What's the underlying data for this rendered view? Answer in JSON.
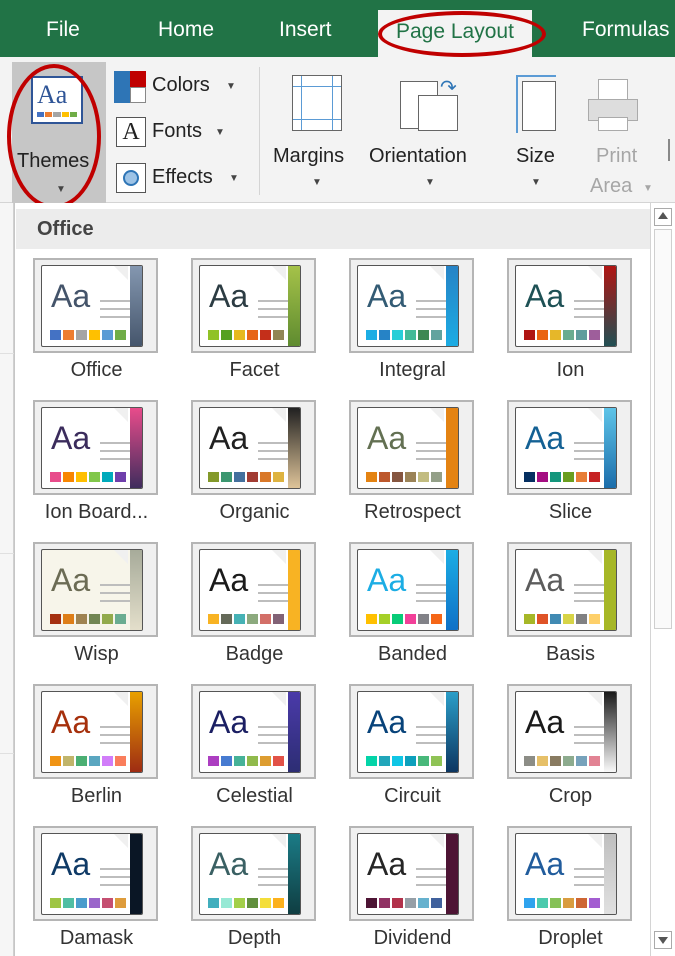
{
  "tabs": [
    {
      "label": "File",
      "active": false
    },
    {
      "label": "Home",
      "active": false
    },
    {
      "label": "Insert",
      "active": false
    },
    {
      "label": "Page Layout",
      "active": true
    },
    {
      "label": "Formulas",
      "active": false
    }
  ],
  "ribbon": {
    "themes_label": "Themes",
    "colors_label": "Colors",
    "fonts_label": "Fonts",
    "effects_label": "Effects",
    "margins_label": "Margins",
    "orientation_label": "Orientation",
    "size_label": "Size",
    "print_label": "Print",
    "area_label": "Area"
  },
  "gallery": {
    "section_header": "Office",
    "themes": [
      {
        "name": "Office",
        "font": "Aa",
        "bg": "#ffffff",
        "text": "#44546a",
        "accent": "#44546a",
        "accent2": "#8497b0",
        "swatches": [
          "#4472c4",
          "#ed7d31",
          "#a5a5a5",
          "#ffc000",
          "#5b9bd5",
          "#70ad47"
        ]
      },
      {
        "name": "Facet",
        "font": "Aa",
        "bg": "#ffffff",
        "text": "#2c3c43",
        "accent": "#5d8a2f",
        "accent2": "#a5c249",
        "swatches": [
          "#90c226",
          "#54a021",
          "#e6b91e",
          "#e76618",
          "#c42f1a",
          "#918655"
        ]
      },
      {
        "name": "Integral",
        "font": "Aa",
        "bg": "#ffffff",
        "text": "#335b74",
        "accent": "#1cade4",
        "accent2": "#2683c6",
        "swatches": [
          "#1cade4",
          "#2683c6",
          "#27ced7",
          "#42ba97",
          "#3e8853",
          "#62a39f"
        ]
      },
      {
        "name": "Ion",
        "font": "Aa",
        "bg": "#ffffff",
        "text": "#1e5155",
        "accent": "#1e5155",
        "accent2": "#b01513",
        "swatches": [
          "#b01513",
          "#ea6312",
          "#e6b729",
          "#6aac90",
          "#5f9c9d",
          "#9e5e9b"
        ]
      },
      {
        "name": "Ion Board...",
        "font": "Aa",
        "bg": "#ffffff",
        "text": "#3b2c5c",
        "accent": "#3b2c5c",
        "accent2": "#e84c8b",
        "swatches": [
          "#e84c8b",
          "#f88600",
          "#ffbf00",
          "#81c74a",
          "#00aabb",
          "#6f3fab"
        ]
      },
      {
        "name": "Organic",
        "font": "Aa",
        "bg": "#ffffff",
        "text": "#212121",
        "accent": "#e3c89c",
        "accent2": "#212121",
        "swatches": [
          "#83992a",
          "#3c9770",
          "#44709d",
          "#a23c33",
          "#d97828",
          "#deb340"
        ]
      },
      {
        "name": "Retrospect",
        "font": "Aa",
        "bg": "#ffffff",
        "text": "#637052",
        "accent": "#e48312",
        "accent2": "#e48312",
        "swatches": [
          "#e48312",
          "#bd582c",
          "#865640",
          "#9b8357",
          "#c2bc80",
          "#94a088"
        ]
      },
      {
        "name": "Slice",
        "font": "Aa",
        "bg": "#ffffff",
        "text": "#146194",
        "accent": "#1a6ba9",
        "accent2": "#5ec4e8",
        "swatches": [
          "#052f61",
          "#a50e82",
          "#14967c",
          "#6a9e1f",
          "#e87d37",
          "#c62324"
        ]
      },
      {
        "name": "Wisp",
        "font": "Aa",
        "bg": "#f7f5ea",
        "text": "#6b6b54",
        "accent": "#e5e0cc",
        "accent2": "#a7ab9a",
        "swatches": [
          "#a53010",
          "#de7e18",
          "#9f8351",
          "#728653",
          "#92aa4c",
          "#6aac91"
        ]
      },
      {
        "name": "Badge",
        "font": "Aa",
        "bg": "#ffffff",
        "text": "#1b1b1b",
        "accent": "#f8b323",
        "accent2": "#f8b323",
        "swatches": [
          "#f8b323",
          "#656a59",
          "#46b2b5",
          "#8caa7e",
          "#d36f68",
          "#826276"
        ]
      },
      {
        "name": "Banded",
        "font": "Aa",
        "bg": "#ffffff",
        "text": "#1cade4",
        "accent": "#0f6fc6",
        "accent2": "#1cade4",
        "swatches": [
          "#ffc000",
          "#a5d028",
          "#08cc78",
          "#f24099",
          "#828288",
          "#f56617"
        ]
      },
      {
        "name": "Basis",
        "font": "Aa",
        "bg": "#ffffff",
        "text": "#5c5c5c",
        "accent": "#a6b727",
        "accent2": "#a6b727",
        "swatches": [
          "#a6b727",
          "#df5327",
          "#418ab3",
          "#d7d447",
          "#818183",
          "#fed06a"
        ]
      },
      {
        "name": "Berlin",
        "font": "Aa",
        "bg": "#ffffff",
        "text": "#a6300c",
        "accent": "#9c2913",
        "accent2": "#e8a000",
        "swatches": [
          "#f09415",
          "#c1b56b",
          "#4baf73",
          "#5aa6c0",
          "#d17df9",
          "#fa7e5c"
        ]
      },
      {
        "name": "Celestial",
        "font": "Aa",
        "bg": "#ffffff",
        "text": "#1b1f63",
        "accent": "#2c2d72",
        "accent2": "#4a3aa9",
        "swatches": [
          "#ac3ec1",
          "#477bd1",
          "#46b298",
          "#90ba4c",
          "#dd9d31",
          "#e25247"
        ]
      },
      {
        "name": "Circuit",
        "font": "Aa",
        "bg": "#ffffff",
        "text": "#08437a",
        "accent": "#0c335e",
        "accent2": "#2b9ec8",
        "swatches": [
          "#03d4a8",
          "#21a6ba",
          "#10c6e5",
          "#0da0bc",
          "#48b87a",
          "#8fc355"
        ]
      },
      {
        "name": "Crop",
        "font": "Aa",
        "bg": "#ffffff",
        "text": "#1a1a1a",
        "accent": "#ffffff",
        "accent2": "#1a1a1a",
        "swatches": [
          "#8c8d86",
          "#e6c069",
          "#897b61",
          "#8dab8e",
          "#77a2bb",
          "#e28394"
        ]
      },
      {
        "name": "Damask",
        "font": "Aa",
        "bg": "#ffffff",
        "text": "#0f3a66",
        "accent": "#0a1625",
        "accent2": "#0a1625",
        "swatches": [
          "#9ec544",
          "#50bea3",
          "#4a9ccc",
          "#9a66ca",
          "#c54f71",
          "#de9c3c"
        ]
      },
      {
        "name": "Depth",
        "font": "Aa",
        "bg": "#ffffff",
        "text": "#3a6063",
        "accent": "#0f3c40",
        "accent2": "#1b7b86",
        "swatches": [
          "#41aebd",
          "#97e9d5",
          "#a2cf49",
          "#608f3d",
          "#f4de3a",
          "#fcb11c"
        ]
      },
      {
        "name": "Dividend",
        "font": "Aa",
        "bg": "#ffffff",
        "text": "#262626",
        "accent": "#4d1434",
        "accent2": "#4d1434",
        "swatches": [
          "#4d1434",
          "#903163",
          "#b2324b",
          "#969fa7",
          "#66b1ce",
          "#40619d"
        ]
      },
      {
        "name": "Droplet",
        "font": "Aa",
        "bg": "#ffffff",
        "text": "#215c9c",
        "accent": "#e1e1e1",
        "accent2": "#bfbfbf",
        "swatches": [
          "#2fa3ee",
          "#4bcaad",
          "#86c157",
          "#d99c3f",
          "#ce6633",
          "#a35dd1"
        ]
      }
    ]
  }
}
